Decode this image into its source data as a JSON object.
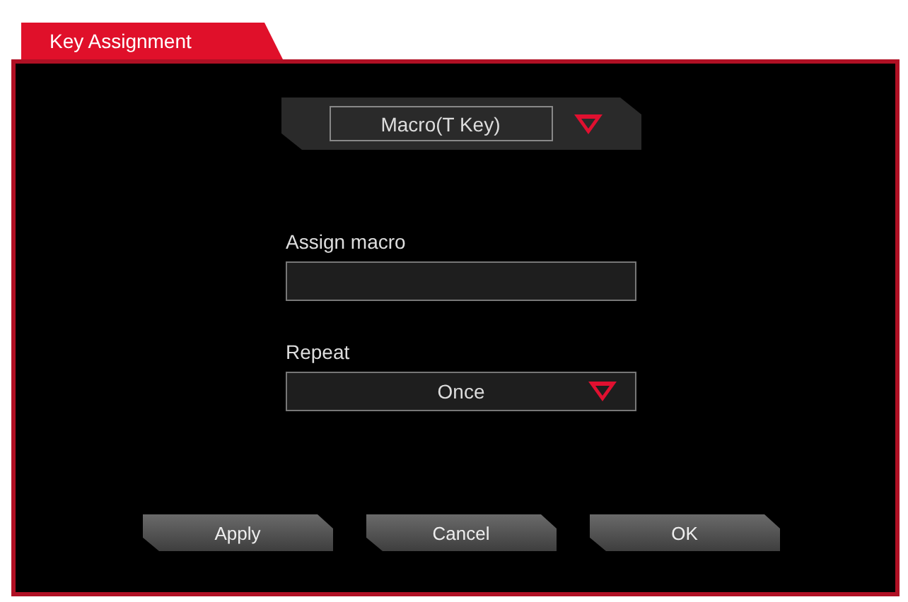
{
  "window": {
    "title": "Key Assignment"
  },
  "mode_dropdown": {
    "value": "Macro(T Key)"
  },
  "assign_macro": {
    "label": "Assign macro"
  },
  "repeat": {
    "label": "Repeat",
    "value": "Once"
  },
  "buttons": [
    {
      "label": "Apply"
    },
    {
      "label": "Cancel"
    },
    {
      "label": "OK"
    }
  ]
}
